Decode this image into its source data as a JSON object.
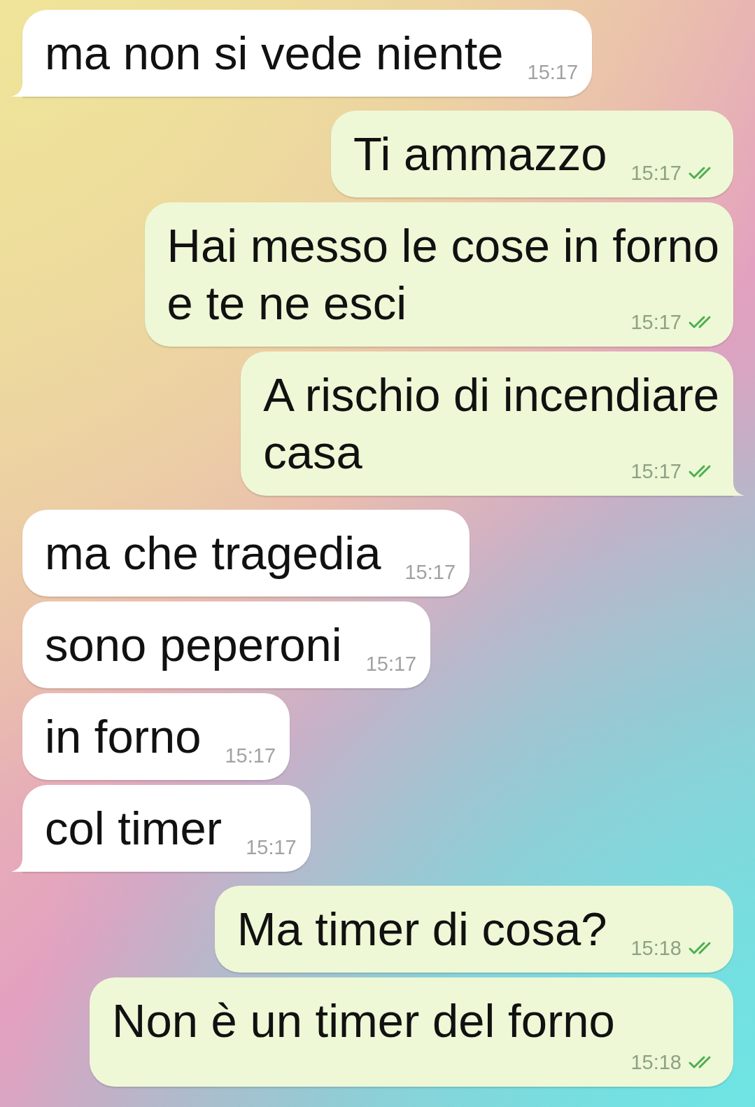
{
  "messages": [
    {
      "kind": "incoming",
      "lines": [
        "ma non si vede niente"
      ],
      "time": "15:17",
      "tail": true
    },
    {
      "kind": "outgoing",
      "lines": [
        "Ti ammazzo"
      ],
      "time": "15:17",
      "read": true,
      "tail": false
    },
    {
      "kind": "outgoing",
      "lines": [
        "Hai messo le cose in forno",
        "e te ne esci"
      ],
      "time": "15:17",
      "read": true,
      "tail": false
    },
    {
      "kind": "outgoing",
      "lines": [
        "A rischio di incendiare",
        "casa"
      ],
      "time": "15:17",
      "read": true,
      "tail": true
    },
    {
      "kind": "incoming",
      "lines": [
        "ma che tragedia"
      ],
      "time": "15:17",
      "tail": false
    },
    {
      "kind": "incoming",
      "lines": [
        "sono peperoni"
      ],
      "time": "15:17",
      "tail": false
    },
    {
      "kind": "incoming",
      "lines": [
        "in forno"
      ],
      "time": "15:17",
      "tail": false
    },
    {
      "kind": "incoming",
      "lines": [
        "col timer"
      ],
      "time": "15:17",
      "tail": true
    },
    {
      "kind": "outgoing",
      "lines": [
        "Ma timer di cosa?"
      ],
      "time": "15:18",
      "read": true,
      "tail": false
    },
    {
      "kind": "outgoing",
      "lines": [
        "Non è un timer del forno"
      ],
      "time": "15:18",
      "read": true,
      "tail": false
    }
  ]
}
